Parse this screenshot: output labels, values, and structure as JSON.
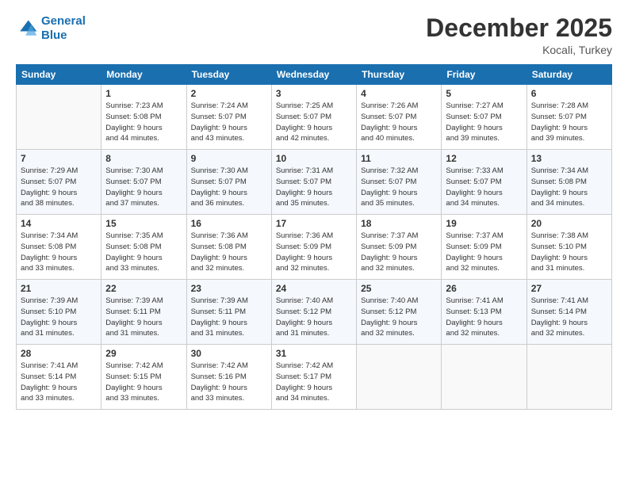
{
  "header": {
    "logo_line1": "General",
    "logo_line2": "Blue",
    "month_title": "December 2025",
    "location": "Kocali, Turkey"
  },
  "weekdays": [
    "Sunday",
    "Monday",
    "Tuesday",
    "Wednesday",
    "Thursday",
    "Friday",
    "Saturday"
  ],
  "weeks": [
    [
      {
        "day": "",
        "info": ""
      },
      {
        "day": "1",
        "info": "Sunrise: 7:23 AM\nSunset: 5:08 PM\nDaylight: 9 hours\nand 44 minutes."
      },
      {
        "day": "2",
        "info": "Sunrise: 7:24 AM\nSunset: 5:07 PM\nDaylight: 9 hours\nand 43 minutes."
      },
      {
        "day": "3",
        "info": "Sunrise: 7:25 AM\nSunset: 5:07 PM\nDaylight: 9 hours\nand 42 minutes."
      },
      {
        "day": "4",
        "info": "Sunrise: 7:26 AM\nSunset: 5:07 PM\nDaylight: 9 hours\nand 40 minutes."
      },
      {
        "day": "5",
        "info": "Sunrise: 7:27 AM\nSunset: 5:07 PM\nDaylight: 9 hours\nand 39 minutes."
      },
      {
        "day": "6",
        "info": "Sunrise: 7:28 AM\nSunset: 5:07 PM\nDaylight: 9 hours\nand 39 minutes."
      }
    ],
    [
      {
        "day": "7",
        "info": "Sunrise: 7:29 AM\nSunset: 5:07 PM\nDaylight: 9 hours\nand 38 minutes."
      },
      {
        "day": "8",
        "info": "Sunrise: 7:30 AM\nSunset: 5:07 PM\nDaylight: 9 hours\nand 37 minutes."
      },
      {
        "day": "9",
        "info": "Sunrise: 7:30 AM\nSunset: 5:07 PM\nDaylight: 9 hours\nand 36 minutes."
      },
      {
        "day": "10",
        "info": "Sunrise: 7:31 AM\nSunset: 5:07 PM\nDaylight: 9 hours\nand 35 minutes."
      },
      {
        "day": "11",
        "info": "Sunrise: 7:32 AM\nSunset: 5:07 PM\nDaylight: 9 hours\nand 35 minutes."
      },
      {
        "day": "12",
        "info": "Sunrise: 7:33 AM\nSunset: 5:07 PM\nDaylight: 9 hours\nand 34 minutes."
      },
      {
        "day": "13",
        "info": "Sunrise: 7:34 AM\nSunset: 5:08 PM\nDaylight: 9 hours\nand 34 minutes."
      }
    ],
    [
      {
        "day": "14",
        "info": "Sunrise: 7:34 AM\nSunset: 5:08 PM\nDaylight: 9 hours\nand 33 minutes."
      },
      {
        "day": "15",
        "info": "Sunrise: 7:35 AM\nSunset: 5:08 PM\nDaylight: 9 hours\nand 33 minutes."
      },
      {
        "day": "16",
        "info": "Sunrise: 7:36 AM\nSunset: 5:08 PM\nDaylight: 9 hours\nand 32 minutes."
      },
      {
        "day": "17",
        "info": "Sunrise: 7:36 AM\nSunset: 5:09 PM\nDaylight: 9 hours\nand 32 minutes."
      },
      {
        "day": "18",
        "info": "Sunrise: 7:37 AM\nSunset: 5:09 PM\nDaylight: 9 hours\nand 32 minutes."
      },
      {
        "day": "19",
        "info": "Sunrise: 7:37 AM\nSunset: 5:09 PM\nDaylight: 9 hours\nand 32 minutes."
      },
      {
        "day": "20",
        "info": "Sunrise: 7:38 AM\nSunset: 5:10 PM\nDaylight: 9 hours\nand 31 minutes."
      }
    ],
    [
      {
        "day": "21",
        "info": "Sunrise: 7:39 AM\nSunset: 5:10 PM\nDaylight: 9 hours\nand 31 minutes."
      },
      {
        "day": "22",
        "info": "Sunrise: 7:39 AM\nSunset: 5:11 PM\nDaylight: 9 hours\nand 31 minutes."
      },
      {
        "day": "23",
        "info": "Sunrise: 7:39 AM\nSunset: 5:11 PM\nDaylight: 9 hours\nand 31 minutes."
      },
      {
        "day": "24",
        "info": "Sunrise: 7:40 AM\nSunset: 5:12 PM\nDaylight: 9 hours\nand 31 minutes."
      },
      {
        "day": "25",
        "info": "Sunrise: 7:40 AM\nSunset: 5:12 PM\nDaylight: 9 hours\nand 32 minutes."
      },
      {
        "day": "26",
        "info": "Sunrise: 7:41 AM\nSunset: 5:13 PM\nDaylight: 9 hours\nand 32 minutes."
      },
      {
        "day": "27",
        "info": "Sunrise: 7:41 AM\nSunset: 5:14 PM\nDaylight: 9 hours\nand 32 minutes."
      }
    ],
    [
      {
        "day": "28",
        "info": "Sunrise: 7:41 AM\nSunset: 5:14 PM\nDaylight: 9 hours\nand 33 minutes."
      },
      {
        "day": "29",
        "info": "Sunrise: 7:42 AM\nSunset: 5:15 PM\nDaylight: 9 hours\nand 33 minutes."
      },
      {
        "day": "30",
        "info": "Sunrise: 7:42 AM\nSunset: 5:16 PM\nDaylight: 9 hours\nand 33 minutes."
      },
      {
        "day": "31",
        "info": "Sunrise: 7:42 AM\nSunset: 5:17 PM\nDaylight: 9 hours\nand 34 minutes."
      },
      {
        "day": "",
        "info": ""
      },
      {
        "day": "",
        "info": ""
      },
      {
        "day": "",
        "info": ""
      }
    ]
  ]
}
